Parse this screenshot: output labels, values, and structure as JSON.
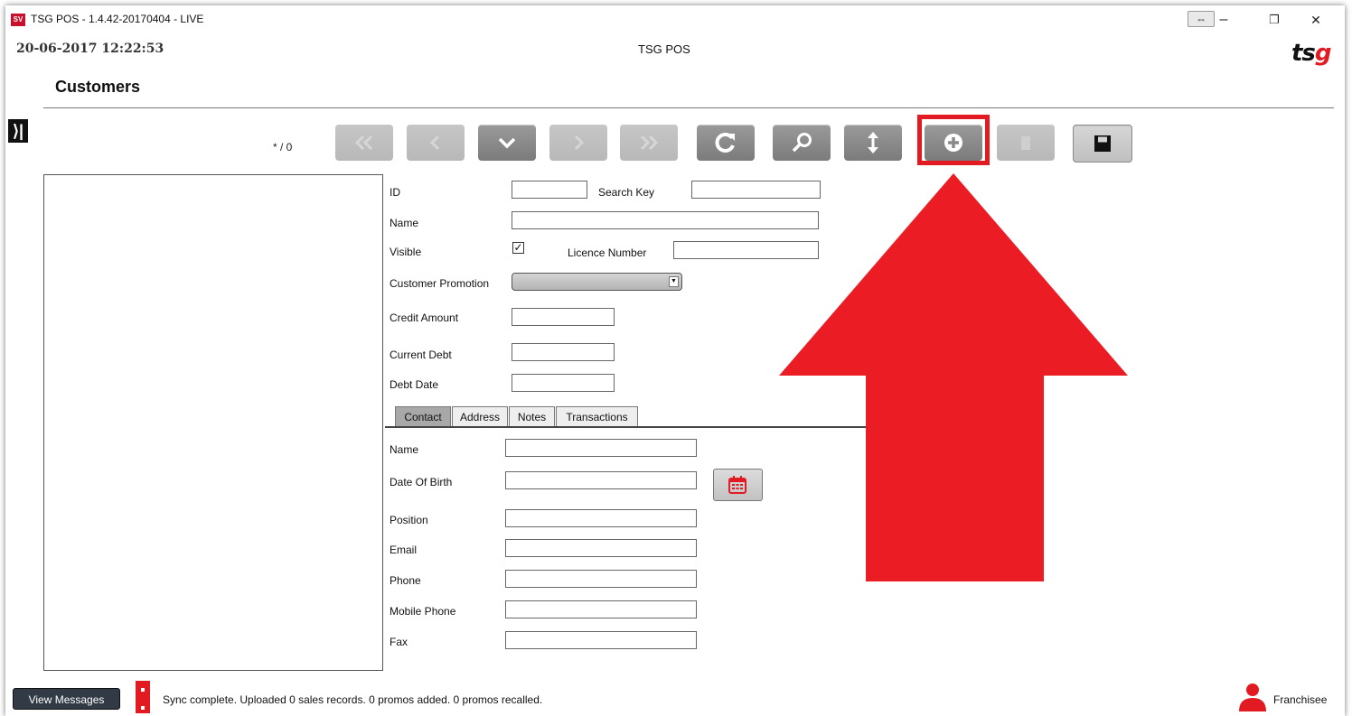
{
  "window": {
    "title": "TSG POS - 1.4.42-20170404 - LIVE",
    "app_icon_text": "SV",
    "resize_glyph": "⇔",
    "minimize_glyph": "–",
    "restore_glyph": "❐",
    "close_glyph": "✕"
  },
  "header": {
    "datetime": "20-06-2017 12:22:53",
    "center_title": "TSG POS",
    "logo_ts": "ts",
    "logo_g": "g",
    "page_title": "Customers",
    "sidebar_toggle_glyph": "⟩|"
  },
  "toolbar": {
    "record_counter": "* / 0",
    "buttons": [
      {
        "name": "first-record",
        "icon": "double-chevron-left-icon",
        "enabled": false
      },
      {
        "name": "previous-record",
        "icon": "chevron-left-icon",
        "enabled": false
      },
      {
        "name": "record-dropdown",
        "icon": "chevron-down-icon",
        "enabled": true
      },
      {
        "name": "next-record",
        "icon": "chevron-right-icon",
        "enabled": false
      },
      {
        "name": "last-record",
        "icon": "double-chevron-right-icon",
        "enabled": false
      },
      {
        "name": "refresh",
        "icon": "refresh-icon",
        "enabled": true
      },
      {
        "name": "search",
        "icon": "magnifier-icon",
        "enabled": true
      },
      {
        "name": "sort",
        "icon": "vertical-arrows-icon",
        "enabled": true
      },
      {
        "name": "add-new",
        "icon": "plus-circle-icon",
        "enabled": true
      },
      {
        "name": "delete",
        "icon": "trash-icon",
        "enabled": false
      },
      {
        "name": "save",
        "icon": "floppy-disk-icon",
        "enabled": true
      }
    ]
  },
  "form": {
    "id_label": "ID",
    "id_value": "",
    "search_key_label": "Search Key",
    "search_key_value": "",
    "name_label": "Name",
    "name_value": "",
    "visible_label": "Visible",
    "visible_checked": true,
    "visible_glyph": "✓",
    "licence_label": "Licence Number",
    "licence_value": "",
    "promotion_label": "Customer Promotion",
    "promotion_value": "",
    "promotion_arrow": "▼",
    "credit_label": "Credit Amount",
    "credit_value": "",
    "debt_label": "Current Debt",
    "debt_value": "",
    "debt_date_label": "Debt Date",
    "debt_date_value": ""
  },
  "tabs": [
    {
      "label": "Contact",
      "active": true
    },
    {
      "label": "Address",
      "active": false
    },
    {
      "label": "Notes",
      "active": false
    },
    {
      "label": "Transactions",
      "active": false
    }
  ],
  "contact": {
    "name_label": "Name",
    "dob_label": "Date Of Birth",
    "position_label": "Position",
    "email_label": "Email",
    "phone_label": "Phone",
    "mobile_label": "Mobile Phone",
    "fax_label": "Fax"
  },
  "footer": {
    "view_messages_label": "View Messages",
    "status_text": "Sync complete.  Uploaded 0 sales records. 0 promos added. 0 promos recalled.",
    "user_role": "Franchisee"
  },
  "colors": {
    "accent_red": "#e21b23",
    "toolbar_button": "#8a8a8a",
    "toolbar_button_disabled": "#c0c0c0",
    "footer_button": "#323a45"
  }
}
